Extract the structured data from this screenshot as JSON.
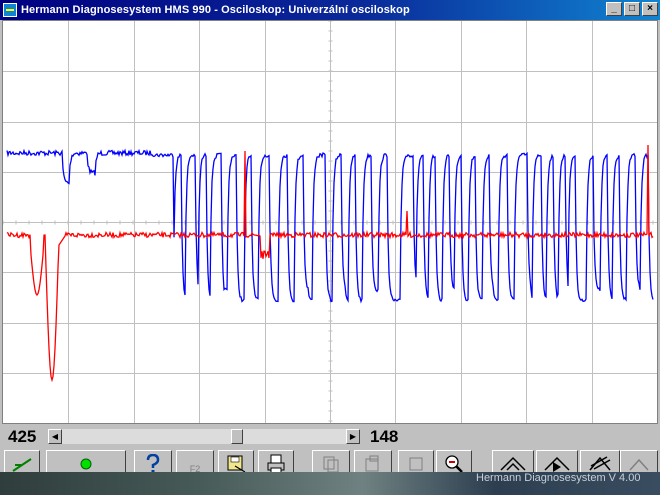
{
  "window": {
    "title": "Hermann Diagnosesystem HMS 990 - Osciloskop: Univerzální osciloskop",
    "controls": {
      "minimize": "_",
      "maximize": "□",
      "close": "×"
    }
  },
  "oscilloscope": {
    "colors": {
      "background": "#ffffff",
      "grid": "#c0c0c0",
      "channel_1": "#0000ff",
      "channel_2": "#ff0000"
    },
    "channels": [
      {
        "channel": 1,
        "color": "#0000ff"
      },
      {
        "channel": 2,
        "color": "#ff0000"
      }
    ]
  },
  "scroll": {
    "position_left": "425",
    "position_right": "148",
    "thumb_fraction": 0.62
  },
  "toolbar": {
    "f2_label": "F2"
  },
  "footer": {
    "version": "Hermann Diagnosesystem V 4.00"
  }
}
